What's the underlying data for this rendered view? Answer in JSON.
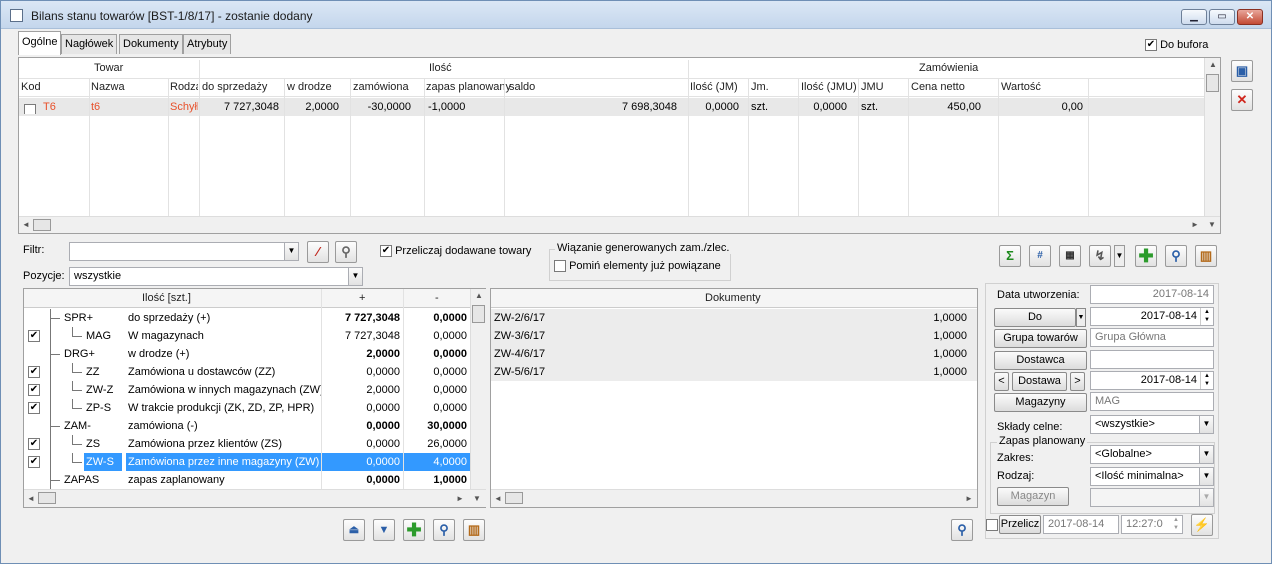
{
  "window": {
    "title": "Bilans stanu towarów [BST-1/8/17] - zostanie dodany"
  },
  "tabs": [
    "Ogólne",
    "Nagłówek",
    "Dokumenty",
    "Atrybuty"
  ],
  "do_bufora": {
    "label": "Do bufora",
    "checked": true
  },
  "top_grid": {
    "group_headers": {
      "towar": "Towar",
      "ilosc": "Ilość",
      "zamowienia": "Zamówienia"
    },
    "columns": [
      "Kod",
      "Nazwa",
      "Rodza",
      "do sprzedaży",
      "w drodze",
      "zamówiona",
      "zapas planowany",
      "saldo",
      "Ilość (JM)",
      "Jm.",
      "Ilość (JMU)",
      "JMU",
      "Cena netto",
      "Wartość"
    ],
    "row": {
      "kod": "T6",
      "nazwa": "t6",
      "rodzaj": "Schyłk",
      "do_sprzedazy": "7 727,3048",
      "w_drodze": "2,0000",
      "zamowiona": "-30,0000",
      "zapas": "-1,0000",
      "saldo": "7 698,3048",
      "ilosc_jm": "0,0000",
      "jm": "szt.",
      "ilosc_jmu": "0,0000",
      "jmu": "szt.",
      "cena": "450,00",
      "wartosc": "0,00"
    }
  },
  "filter": {
    "label": "Filtr:",
    "value": ""
  },
  "pozycje": {
    "label": "Pozycje:",
    "value": "wszystkie"
  },
  "przeliczaj": {
    "label": "Przeliczaj dodawane towary",
    "checked": true
  },
  "wiazanie": {
    "legend": "Wiązanie generowanych zam./zlec.",
    "pomin_label": "Pomiń elementy już powiązane",
    "pomin_checked": false
  },
  "left_grid": {
    "headers": {
      "ilosc": "Ilość [szt.]",
      "plus": "+",
      "minus": "-"
    },
    "rows": [
      {
        "check": false,
        "code": "SPR+",
        "desc": "do sprzedaży (+)",
        "plus": "7 727,3048",
        "minus": "0,0000",
        "bold": true,
        "level": 0,
        "selected": false
      },
      {
        "check": true,
        "code": "MAG",
        "desc": "W magazynach",
        "plus": "7 727,3048",
        "minus": "0,0000",
        "bold": false,
        "level": 1,
        "selected": false
      },
      {
        "check": false,
        "code": "DRG+",
        "desc": "w drodze (+)",
        "plus": "2,0000",
        "minus": "0,0000",
        "bold": true,
        "level": 0,
        "selected": false
      },
      {
        "check": true,
        "code": "ZZ",
        "desc": "Zamówiona u dostawców (ZZ)",
        "plus": "0,0000",
        "minus": "0,0000",
        "bold": false,
        "level": 1,
        "selected": false
      },
      {
        "check": true,
        "code": "ZW-Z",
        "desc": "Zamówiona w innych magazynach (ZW)",
        "plus": "2,0000",
        "minus": "0,0000",
        "bold": false,
        "level": 1,
        "selected": false
      },
      {
        "check": true,
        "code": "ZP-S",
        "desc": "W trakcie produkcji (ZK, ZD, ZP, HPR)",
        "plus": "0,0000",
        "minus": "0,0000",
        "bold": false,
        "level": 1,
        "selected": false
      },
      {
        "check": false,
        "code": "ZAM-",
        "desc": "zamówiona (-)",
        "plus": "0,0000",
        "minus": "30,0000",
        "bold": true,
        "level": 0,
        "selected": false
      },
      {
        "check": true,
        "code": "ZS",
        "desc": "Zamówiona przez klientów (ZS)",
        "plus": "0,0000",
        "minus": "26,0000",
        "bold": false,
        "level": 1,
        "selected": false
      },
      {
        "check": true,
        "code": "ZW-S",
        "desc": "Zamówiona przez inne magazyny (ZW)",
        "plus": "0,0000",
        "minus": "4,0000",
        "bold": false,
        "level": 1,
        "selected": true
      },
      {
        "check": false,
        "code": "ZAPAS",
        "desc": "zapas zaplanowany",
        "plus": "0,0000",
        "minus": "1,0000",
        "bold": true,
        "level": 0,
        "selected": false
      }
    ]
  },
  "docs_grid": {
    "header": "Dokumenty",
    "rows": [
      {
        "doc": "ZW-2/6/17",
        "qty": "1,0000"
      },
      {
        "doc": "ZW-3/6/17",
        "qty": "1,0000"
      },
      {
        "doc": "ZW-4/6/17",
        "qty": "1,0000"
      },
      {
        "doc": "ZW-5/6/17",
        "qty": "1,0000"
      }
    ]
  },
  "right_panel": {
    "data_utworzenia_label": "Data utworzenia:",
    "data_utworzenia": "2017-08-14",
    "do_label": "Do",
    "do_date": "2017-08-14",
    "grupa_label": "Grupa towarów",
    "grupa_value": "Grupa Główna",
    "dostawca_label": "Dostawca",
    "dostawca_value": "",
    "dostawa_label": "Dostawa",
    "dostawa_date": "2017-08-14",
    "magazyny_label": "Magazyny",
    "magazyny_value": "MAG",
    "sklady_label": "Składy celne:",
    "sklady_value": "<wszystkie>",
    "zapas_legend": "Zapas planowany",
    "zakres_label": "Zakres:",
    "zakres_value": "<Globalne>",
    "rodzaj_label": "Rodzaj:",
    "rodzaj_value": "<Ilość minimalna>",
    "magazyn_label": "Magazyn",
    "przelicz_label": "Przelicz",
    "przelicz_date": "2017-08-14",
    "przelicz_time": "12:27:0"
  }
}
